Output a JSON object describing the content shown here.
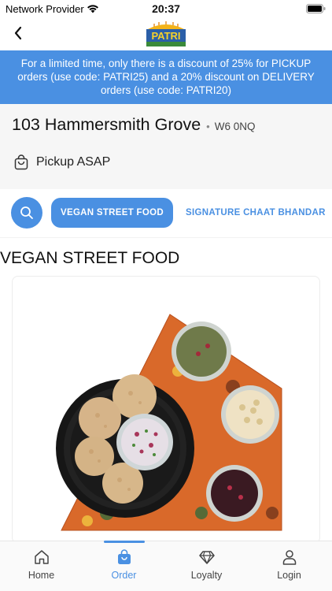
{
  "status_bar": {
    "carrier": "Network Provider",
    "time": "20:37"
  },
  "header": {
    "logo_text": "PATRI",
    "logo_tagline": "PATRI"
  },
  "promo": {
    "text": "For a limited time, only there is a discount of 25% for PICKUP orders (use code: PATRI25) and a 20% discount on DELIVERY orders (use code: PATRI20)"
  },
  "location": {
    "street": "103 Hammersmith Grove",
    "separator": "•",
    "postcode": "W6 0NQ",
    "pickup_label": "Pickup ASAP"
  },
  "categories": {
    "active": "VEGAN STREET FOOD",
    "next": "SIGNATURE CHAAT BHANDAR"
  },
  "section": {
    "title": "VEGAN STREET FOOD"
  },
  "tabs": [
    {
      "label": "Home",
      "icon": "home-icon"
    },
    {
      "label": "Order",
      "icon": "bag-icon",
      "active": true
    },
    {
      "label": "Loyalty",
      "icon": "diamond-icon"
    },
    {
      "label": "Login",
      "icon": "user-icon"
    }
  ],
  "colors": {
    "accent": "#4a90e2",
    "background_grey": "#f6f6f6",
    "tray_orange": "#e0702a"
  }
}
